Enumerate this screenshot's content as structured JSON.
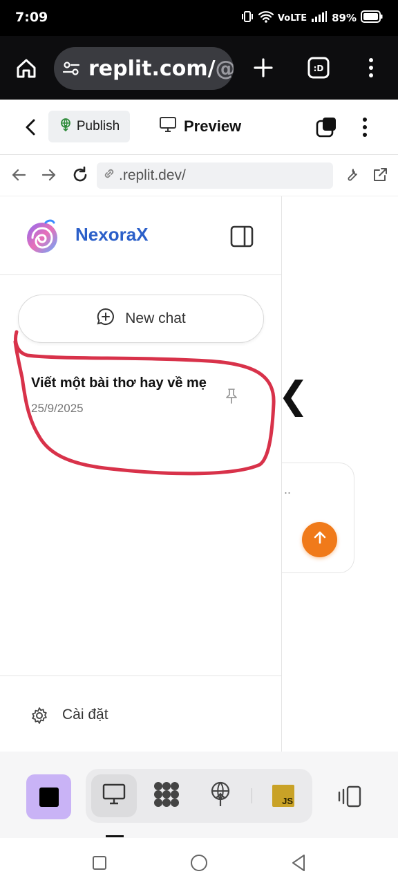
{
  "status_bar": {
    "time": "7:09",
    "network": "VoLTE",
    "battery": "89%"
  },
  "browser": {
    "url_main": "replit.com/",
    "url_rest": "@t"
  },
  "replit_bar": {
    "publish_label": "Publish",
    "preview_label": "Preview"
  },
  "preview_nav": {
    "address": ".replit.dev/"
  },
  "sidebar": {
    "brand_name": "NexoraX",
    "new_chat_label": "New chat",
    "chats": [
      {
        "title": "Viết một bài thơ hay về mẹ",
        "date": "25/9/2025"
      }
    ],
    "settings_label": "Cài đặt"
  },
  "main": {
    "glyph": "❮",
    "ellipsis": ".."
  },
  "toolbar": {
    "js_label": "JS"
  },
  "colors": {
    "brand_blue": "#2b5fc9",
    "accent_orange": "#f07a1a",
    "annotation_red": "#d8324a",
    "stop_purple": "#c9b3f6"
  }
}
